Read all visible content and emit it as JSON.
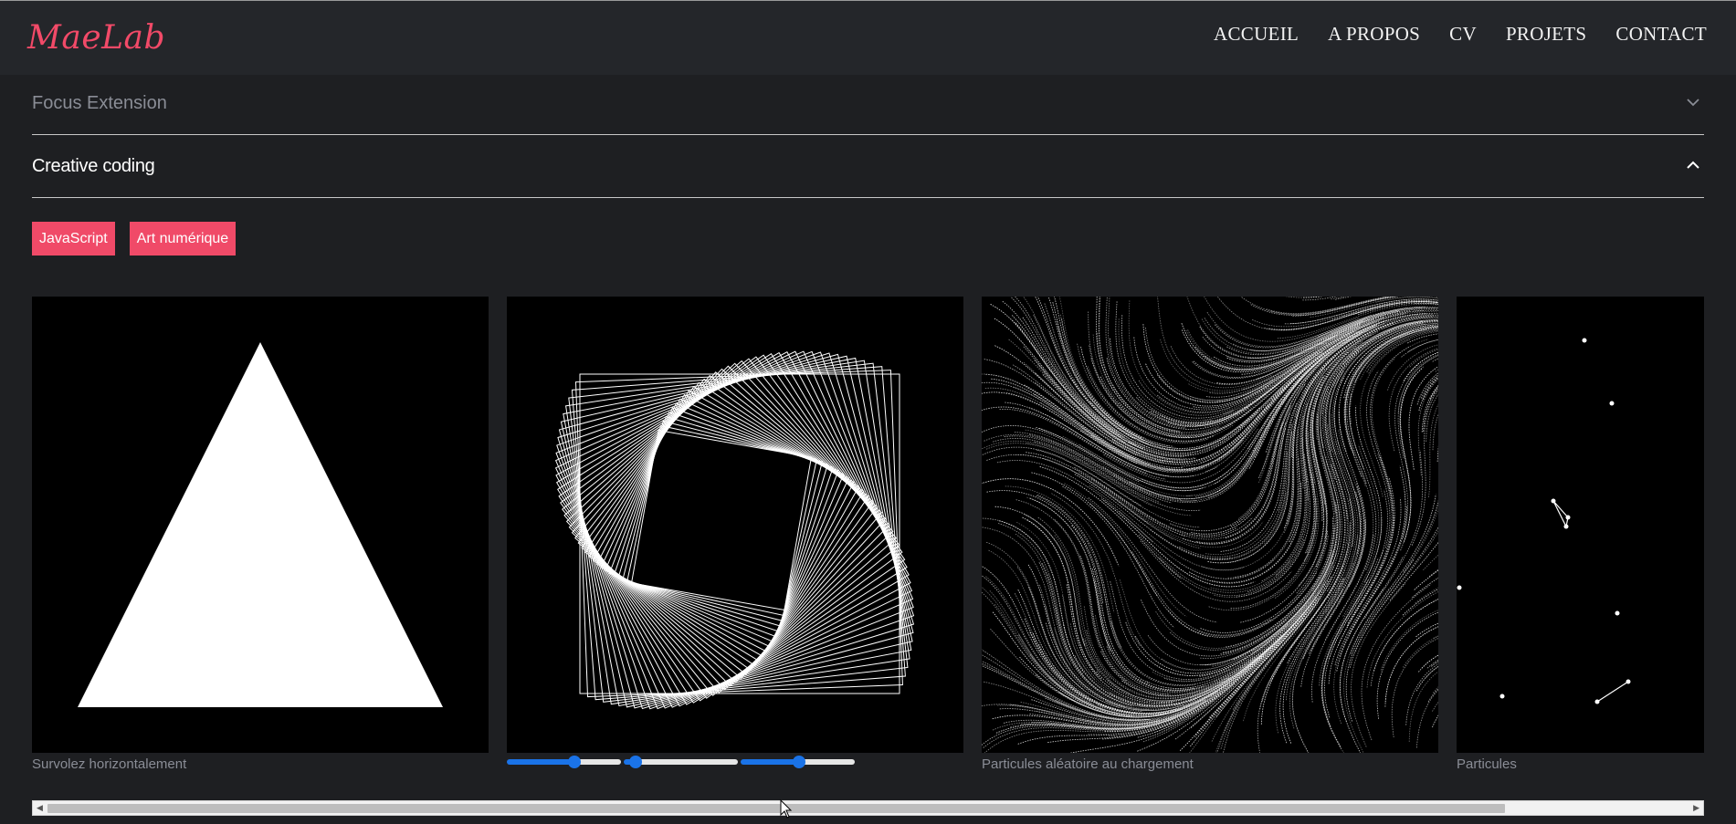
{
  "header": {
    "logo": "MaeLab",
    "nav": [
      "ACCUEIL",
      "A PROPOS",
      "CV",
      "PROJETS",
      "CONTACT"
    ]
  },
  "accordion": [
    {
      "title": "Focus Extension",
      "expanded": false
    },
    {
      "title": "Creative coding",
      "expanded": true
    }
  ],
  "tags": [
    "JavaScript",
    "Art numérique"
  ],
  "gallery": {
    "captions": {
      "triangle": "Survolez horizontalement",
      "flow": "Particules aléatoire au chargement",
      "particles": "Particules"
    },
    "sliders": [
      0.58,
      0.08,
      0.5
    ]
  },
  "scrollbar": {
    "position": 0.0,
    "visible_fraction": 0.87
  },
  "colors": {
    "accent": "#f04a68",
    "background": "#1e1f22",
    "header": "#24262a",
    "slider": "#1a73e8"
  },
  "icons": {
    "collapsed": "chevron-down-icon",
    "expanded": "chevron-up-icon"
  }
}
